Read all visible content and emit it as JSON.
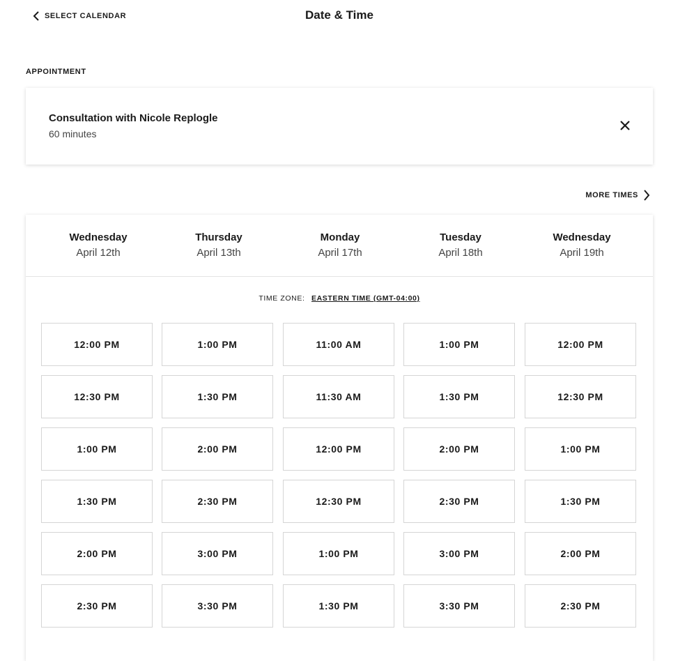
{
  "header": {
    "back_label": "SELECT CALENDAR",
    "title": "Date & Time"
  },
  "appointment": {
    "section_label": "APPOINTMENT",
    "name": "Consultation with Nicole Replogle",
    "duration": "60 minutes"
  },
  "more_times_label": "MORE TIMES",
  "timezone": {
    "label": "TIME ZONE:",
    "value": "EASTERN TIME (GMT-04:00)"
  },
  "days": [
    {
      "name": "Wednesday",
      "date": "April 12th",
      "slots": [
        "12:00 PM",
        "12:30 PM",
        "1:00 PM",
        "1:30 PM",
        "2:00 PM",
        "2:30 PM"
      ]
    },
    {
      "name": "Thursday",
      "date": "April 13th",
      "slots": [
        "1:00 PM",
        "1:30 PM",
        "2:00 PM",
        "2:30 PM",
        "3:00 PM",
        "3:30 PM"
      ]
    },
    {
      "name": "Monday",
      "date": "April 17th",
      "slots": [
        "11:00 AM",
        "11:30 AM",
        "12:00 PM",
        "12:30 PM",
        "1:00 PM",
        "1:30 PM"
      ]
    },
    {
      "name": "Tuesday",
      "date": "April 18th",
      "slots": [
        "1:00 PM",
        "1:30 PM",
        "2:00 PM",
        "2:30 PM",
        "3:00 PM",
        "3:30 PM"
      ]
    },
    {
      "name": "Wednesday",
      "date": "April 19th",
      "slots": [
        "12:00 PM",
        "12:30 PM",
        "1:00 PM",
        "1:30 PM",
        "2:00 PM",
        "2:30 PM"
      ]
    }
  ]
}
